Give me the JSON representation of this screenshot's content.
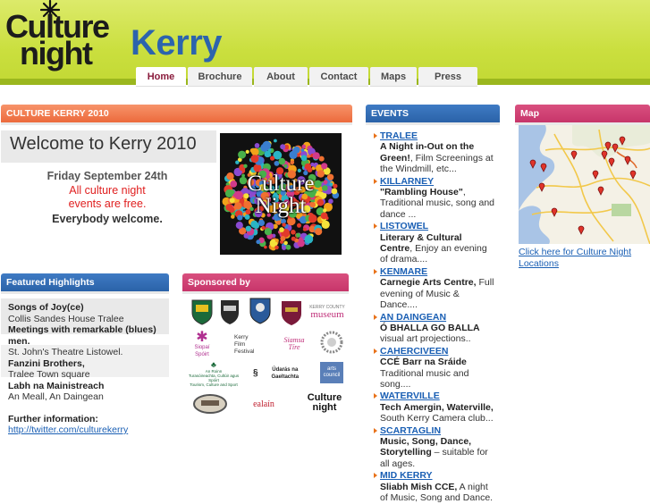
{
  "header": {
    "logo_line1": "Culture",
    "logo_line2": "night",
    "county": "Kerry"
  },
  "nav": {
    "tabs": [
      {
        "label": "Home",
        "active": true
      },
      {
        "label": "Brochure",
        "active": false
      },
      {
        "label": "About",
        "active": false
      },
      {
        "label": "Contact",
        "active": false
      },
      {
        "label": "Maps",
        "active": false
      },
      {
        "label": "Press",
        "active": false
      }
    ]
  },
  "main": {
    "section_title": "CULTURE KERRY 2010",
    "welcome": "Welcome to Kerry 2010",
    "date_line": "Friday September 24th",
    "free_line1": "All culture night",
    "free_line2": "events are free.",
    "welcome_line": "Everybody welcome.",
    "poster_line1": "Culture",
    "poster_line2": "Night"
  },
  "featured": {
    "title": "Featured Highlights",
    "items": [
      {
        "title": "Songs of Joy(ce)",
        "venue": "Collis Sandes House Tralee"
      },
      {
        "title": "Meetings with remarkable (blues) men.",
        "venue": "St. John's Theatre Listowel."
      },
      {
        "title": "Fanzini Brothers,",
        "venue": "Tralee Town square"
      },
      {
        "title": "Labh na Mainistreach",
        "venue": "An Meall, An Daingean"
      }
    ],
    "further_label": "Further information:",
    "link": "http://twitter.com/culturekerry"
  },
  "sponsors": {
    "title": "Sponsored by",
    "labels": {
      "museum_kerry": "KERRY COUNTY",
      "museum": "museum",
      "siamsa": "Siamsa Tíre",
      "film1": "Kerry",
      "film2": "Film",
      "film3": "Festival",
      "ealain": "ealaín",
      "udaras": "Údarás na Gaeltachta",
      "arts": "arts council",
      "dept1": "An Roinn",
      "dept2": "Turasóireachta, Cultúir agus Spóirt",
      "dept3": "Tourism, Culture and Sport",
      "cn1": "Culture",
      "cn2": "night",
      "siopa": "Siopaí Spóirt"
    }
  },
  "events": {
    "title": "EVENTS",
    "items": [
      {
        "town": "TRALEE",
        "title": "A Night in-Out on the Green!",
        "desc": ", Film Screenings at the Windmill, etc..."
      },
      {
        "town": "KILLARNEY",
        "title": "\"Rambling House\"",
        "desc": ", Traditional music, song and dance ..."
      },
      {
        "town": "LISTOWEL",
        "title": "Literary & Cultural Centre",
        "desc": ", Enjoy an evening of drama...."
      },
      {
        "town": "KENMARE",
        "title": "Carnegie Arts Centre,",
        "desc": " Full evening of Music & Dance...."
      },
      {
        "town": "AN DAINGEAN",
        "title": "Ó BHALLA GO BALLA",
        "desc": " visual art projections.."
      },
      {
        "town": "CAHERCIVEEN",
        "title": "CCÉ Barr na Sráide",
        "desc": " Traditional music and song...."
      },
      {
        "town": "WATERVILLE",
        "title": "Tech Amergin, Waterville,",
        "desc": " South Kerry Camera club..."
      },
      {
        "town": "SCARTAGLIN",
        "title": "Music, Song, Dance, Storytelling",
        "desc": " – suitable for all ages."
      },
      {
        "town": "MID KERRY",
        "title": "Sliabh Mish CCE,",
        "desc": " A night of Music, Song and Dance."
      }
    ]
  },
  "map": {
    "title": "Map",
    "link": "Click here for Culture Night Locations"
  },
  "colors": {
    "header_green": "#c8dd3c",
    "kerry_blue": "#2c64ad",
    "orange_header": "#ee6e3f",
    "blue_header": "#2f69b3",
    "magenta_header": "#cf3c6f",
    "red_text": "#e02020",
    "link_blue": "#1a5fb4"
  }
}
